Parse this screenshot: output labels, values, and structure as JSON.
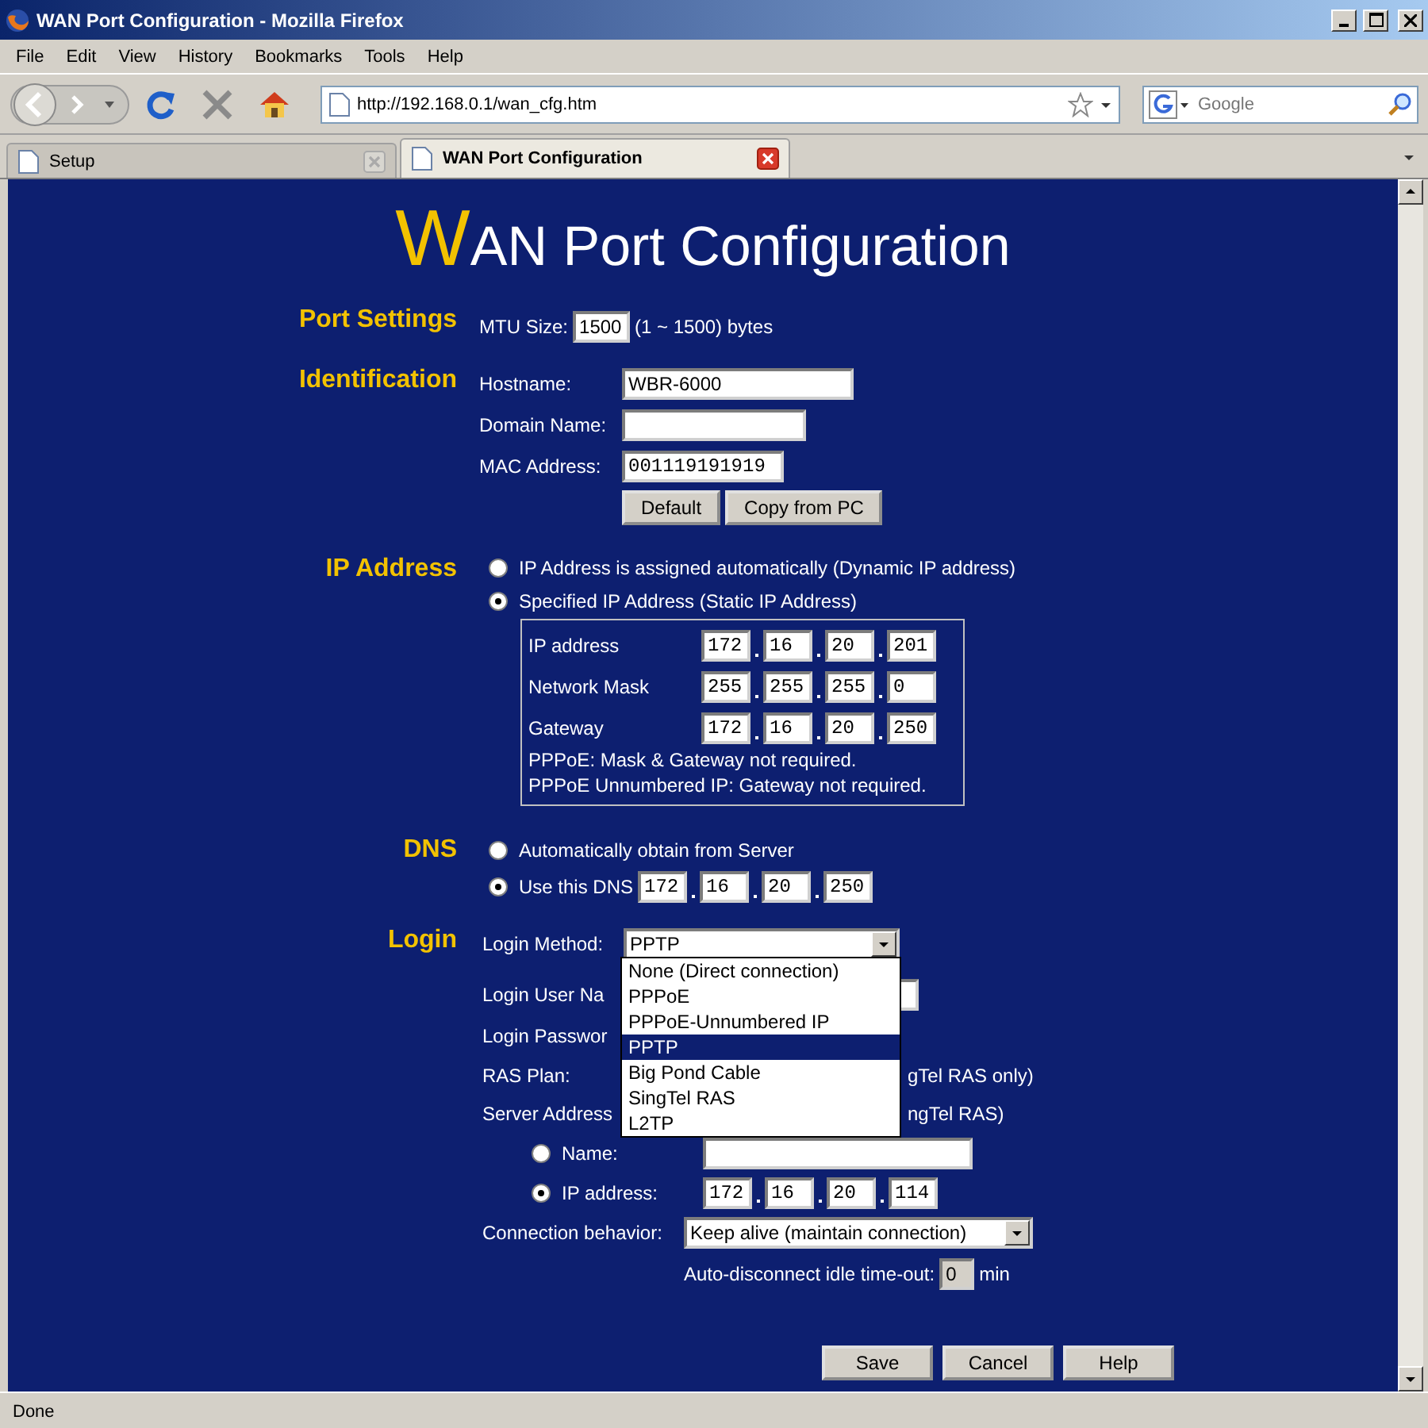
{
  "window": {
    "title": "WAN Port Configuration - Mozilla Firefox"
  },
  "menu": [
    "File",
    "Edit",
    "View",
    "History",
    "Bookmarks",
    "Tools",
    "Help"
  ],
  "address_bar": {
    "value": "http://192.168.0.1/wan_cfg.htm"
  },
  "search": {
    "placeholder": "Google"
  },
  "tabs": [
    {
      "label": "Setup",
      "selected": false
    },
    {
      "label": "WAN Port Configuration",
      "selected": true
    }
  ],
  "page": {
    "title_initial": "W",
    "title_rest": "AN Port Configuration",
    "port_settings": {
      "heading": "Port Settings",
      "mtu_label": "MTU Size:",
      "mtu_value": "1500",
      "mtu_hint": "(1 ~ 1500) bytes"
    },
    "identification": {
      "heading": "Identification",
      "fields": [
        {
          "label": "Hostname:",
          "value": "WBR-6000"
        },
        {
          "label": "Domain Name:"
        },
        {
          "label": "MAC Address:",
          "value": "001119191919"
        }
      ],
      "buttons": [
        "Default",
        "Copy from PC"
      ]
    },
    "ip_address": {
      "heading": "IP Address",
      "options": [
        {
          "label": "IP Address is assigned automatically (Dynamic IP address)",
          "selected": false
        },
        {
          "label": "Specified IP Address (Static IP Address)",
          "selected": true
        }
      ],
      "rows": [
        {
          "label": "IP address",
          "octets": [
            "172",
            "16",
            "20",
            "201"
          ]
        },
        {
          "label": "Network Mask",
          "octets": [
            "255",
            "255",
            "255",
            "0"
          ]
        },
        {
          "label": "Gateway",
          "octets": [
            "172",
            "16",
            "20",
            "250"
          ]
        }
      ],
      "notes": [
        "PPPoE: Mask & Gateway not required.",
        "PPPoE Unnumbered IP: Gateway not required."
      ]
    },
    "dns": {
      "heading": "DNS",
      "options": [
        {
          "label": "Automatically obtain from Server",
          "selected": false
        },
        {
          "label": "Use this DNS",
          "selected": true,
          "octets": [
            "172",
            "16",
            "20",
            "250"
          ]
        }
      ]
    },
    "login": {
      "heading": "Login",
      "method_label": "Login Method:",
      "method_value": "PPTP",
      "expanded": true,
      "method_options": [
        {
          "label": "None (Direct connection)",
          "selected": false
        },
        {
          "label": "PPPoE",
          "selected": false
        },
        {
          "label": "PPPoE-Unnumbered IP",
          "selected": false
        },
        {
          "label": "PPTP",
          "selected": true
        },
        {
          "label": "Big Pond Cable",
          "selected": false
        },
        {
          "label": "SingTel RAS",
          "selected": false
        },
        {
          "label": "L2TP",
          "selected": false
        }
      ],
      "user_name_label": "Login User Na",
      "password_label": "Login Passwor",
      "ras_plan_label": "RAS Plan:",
      "ras_plan_note": "gTel RAS only)",
      "server_address_label": "Server Address",
      "server_address_note": "ngTel RAS)",
      "server_options": [
        {
          "label": "Name:",
          "selected": false
        },
        {
          "label": "IP address:",
          "selected": true,
          "octets": [
            "172",
            "16",
            "20",
            "114"
          ]
        }
      ],
      "connection_label": "Connection behavior:",
      "connection_value": "Keep alive (maintain connection)",
      "idle_label": "Auto-disconnect idle time-out:",
      "idle_value": "0",
      "idle_unit": "min"
    },
    "buttons": [
      "Save",
      "Cancel",
      "Help"
    ]
  },
  "status_bar": "Done"
}
